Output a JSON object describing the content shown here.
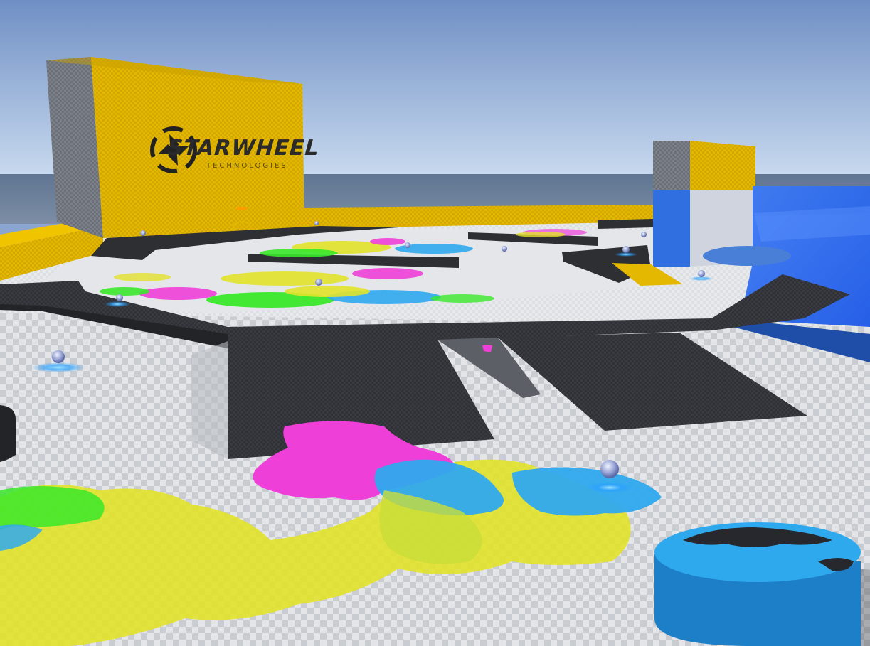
{
  "scene": {
    "type": "3d-game-viewport",
    "environment": "paint-splat arena",
    "colors": {
      "sky_top": "#6f8fc4",
      "sky_horizon": "#c8d9ef",
      "wall_yellow": "#e6b800",
      "ramp_dark": "#2e2f33",
      "floor_light": "#d9dce0",
      "paint_magenta": "#ee3fd8",
      "paint_yellow": "#e2e22a",
      "paint_green": "#39e82a",
      "paint_blue": "#2fa9ee",
      "water_blue": "#2f6df0"
    }
  },
  "billboard": {
    "brand": "STARWHEEL",
    "tagline": "TECHNOLOGIES",
    "logo_icon": "starwheel-logo-icon"
  }
}
